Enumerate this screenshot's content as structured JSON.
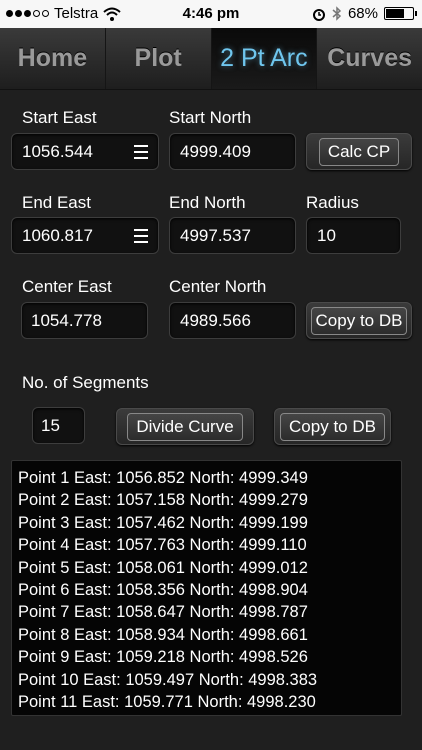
{
  "status": {
    "carrier": "Telstra",
    "time": "4:46 pm",
    "battery": "68%",
    "battery_level": 0.68
  },
  "tabs": [
    {
      "label": "Home",
      "active": false
    },
    {
      "label": "Plot",
      "active": false
    },
    {
      "label": "2 Pt Arc",
      "active": true
    },
    {
      "label": "Curves",
      "active": false
    }
  ],
  "form": {
    "start_east_label": "Start East",
    "start_east_value": "1056.544",
    "start_north_label": "Start North",
    "start_north_value": "4999.409",
    "calc_cp_label": "Calc CP",
    "end_east_label": "End East",
    "end_east_value": "1060.817",
    "end_north_label": "End North",
    "end_north_value": "4997.537",
    "radius_label": "Radius",
    "radius_value": "10",
    "center_east_label": "Center East",
    "center_east_value": "1054.778",
    "center_north_label": "Center North",
    "center_north_value": "4989.566",
    "copy_db_label_1": "Copy to DB",
    "segments_label": "No. of Segments",
    "segments_value": "15",
    "divide_label": "Divide Curve",
    "copy_db_label_2": "Copy to DB"
  },
  "results": [
    "Point 1 East: 1056.852 North: 4999.349",
    "Point 2 East: 1057.158 North: 4999.279",
    "Point 3 East: 1057.462 North: 4999.199",
    "Point 4 East: 1057.763 North: 4999.110",
    "Point 5 East: 1058.061 North: 4999.012",
    "Point 6 East: 1058.356 North: 4998.904",
    "Point 7 East: 1058.647 North: 4998.787",
    "Point 8 East: 1058.934 North: 4998.661",
    "Point 9 East: 1059.218 North: 4998.526",
    "Point 10 East: 1059.497 North: 4998.383",
    "Point 11 East: 1059.771 North: 4998.230"
  ]
}
